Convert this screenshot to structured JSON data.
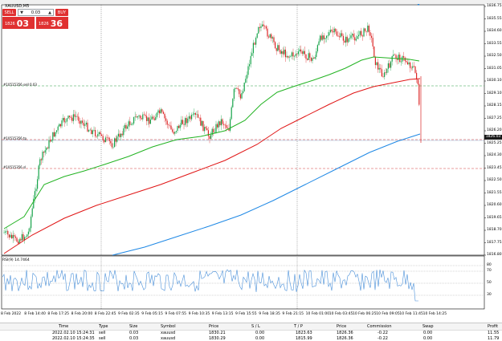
{
  "symbol": "XAUUSD,M5",
  "trade_panel": {
    "sell_label": "SELL",
    "buy_label": "BUY",
    "lot": "0.03",
    "down_arrow": "▼",
    "up_arrow": "▲",
    "sell_price_small": "1826",
    "sell_price_big": "03",
    "buy_price_small": "1826",
    "buy_price_big": "36"
  },
  "y_axis": [
    "1836.75",
    "1835.55",
    "1834.60",
    "1833.55",
    "1832.50",
    "1831.05",
    "1830.10",
    "1829.10",
    "1828.15",
    "1827.25",
    "1826.20",
    "1825.25",
    "1824.30",
    "1823.45",
    "1822.50",
    "1821.55",
    "1820.60",
    "1819.65",
    "1818.70",
    "1817.75",
    "1816.80"
  ],
  "x_axis": [
    "8 Feb 2022",
    "8 Feb 14:40",
    "8 Feb 17:25",
    "8 Feb 20:00",
    "8 Feb 22:45",
    "9 Feb 02:35",
    "9 Feb 05:15",
    "9 Feb 07:55",
    "9 Feb 10:35",
    "9 Feb 13:15",
    "9 Feb 15:55",
    "9 Feb 18:35",
    "9 Feb 21:15",
    "10 Feb 01:00",
    "10 Feb 03:45",
    "10 Feb 06:25",
    "10 Feb 09:05",
    "10 Feb 11:45",
    "10 Feb 14:25"
  ],
  "current_price": "1826.03",
  "levels": {
    "tp_label": "#10515356 sell 0.03",
    "sl_label": "#10515356 tp",
    "entry_label": "#10515356 sl"
  },
  "rsi": {
    "label": "RSI(9) 14.7464",
    "levels": [
      "80",
      "70",
      "50",
      "30"
    ]
  },
  "table": {
    "headers": [
      "Time",
      "Type",
      "Size",
      "Symbol",
      "Price",
      "S / L",
      "T / P",
      "Price",
      "Commission",
      "Swap",
      "Profit"
    ],
    "rows": [
      [
        "2022.02.10 15:24:31",
        "sell",
        "0.03",
        "xauusd",
        "1830.21",
        "0.00",
        "1823.63",
        "1826.36",
        "-0.22",
        "0.00",
        "11.55"
      ],
      [
        "2022.02.10 15:24:35",
        "sell",
        "0.03",
        "xauusd",
        "1830.29",
        "0.00",
        "1815.99",
        "1826.36",
        "-0.22",
        "0.00",
        "11.79"
      ]
    ]
  },
  "colors": {
    "candle_up": "#16a34a",
    "candle_down": "#dc2626",
    "ma_fast": "#22b322",
    "ma_mid": "#e01414",
    "ma_slow": "#1e88e5",
    "rsi_line": "#4a90d9",
    "sell_red": "#e03131"
  }
}
